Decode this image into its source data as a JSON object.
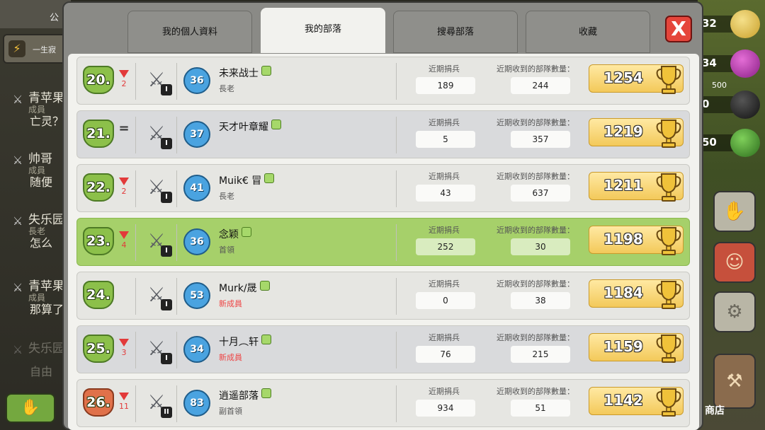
{
  "background": {
    "left": {
      "top_strip_label": "公",
      "clan_bar_label": "一生寂",
      "chat": [
        {
          "name": "青苹果",
          "role": "成員",
          "message": "亡灵？"
        },
        {
          "name": "帅哥",
          "role": "成員",
          "message": "随便"
        },
        {
          "name": "失乐园",
          "role": "長老",
          "message": "怎么"
        },
        {
          "name": "青苹果",
          "role": "成員",
          "message": "那算了"
        },
        {
          "name": "失乐园",
          "role": "",
          "message": "自由"
        }
      ]
    },
    "right": {
      "resources": [
        {
          "value": "32",
          "cap": ""
        },
        {
          "value": "34",
          "cap": ""
        },
        {
          "value": "0",
          "cap": "500"
        },
        {
          "value": "50",
          "cap": ""
        }
      ],
      "shop_label": "商店"
    }
  },
  "tabs": [
    {
      "label": "我的個人資料",
      "active": false
    },
    {
      "label": "我的部落",
      "active": true
    },
    {
      "label": "搜尋部落",
      "active": false
    },
    {
      "label": "收藏",
      "active": false
    }
  ],
  "close_label": "X",
  "labels": {
    "donated": "近期捐兵",
    "received": "近期收到的部隊數量："
  },
  "members": [
    {
      "rank": "20.",
      "trend": "down",
      "trend_value": "2",
      "war_level": "I",
      "xp": "36",
      "name": "未来战士",
      "role": "長老",
      "role_new": false,
      "donated": "189",
      "received": "244",
      "trophies": "1254",
      "self": false,
      "badge": "green"
    },
    {
      "rank": "21.",
      "trend": "same",
      "trend_value": "",
      "war_level": "I",
      "xp": "37",
      "name": "天才叶章耀",
      "role": "",
      "role_new": false,
      "donated": "5",
      "received": "357",
      "trophies": "1219",
      "self": false,
      "badge": "green"
    },
    {
      "rank": "22.",
      "trend": "down",
      "trend_value": "2",
      "war_level": "I",
      "xp": "41",
      "name": "Muik€ 冒",
      "role": "長老",
      "role_new": false,
      "donated": "43",
      "received": "637",
      "trophies": "1211",
      "self": false,
      "badge": "green"
    },
    {
      "rank": "23.",
      "trend": "down",
      "trend_value": "4",
      "war_level": "I",
      "xp": "36",
      "name": "念颖",
      "role": "首領",
      "role_new": false,
      "donated": "252",
      "received": "30",
      "trophies": "1198",
      "self": true,
      "badge": "green"
    },
    {
      "rank": "24.",
      "trend": "none",
      "trend_value": "",
      "war_level": "I",
      "xp": "53",
      "name": "Murk/晟",
      "role": "新成員",
      "role_new": true,
      "donated": "0",
      "received": "38",
      "trophies": "1184",
      "self": false,
      "badge": "green"
    },
    {
      "rank": "25.",
      "trend": "down",
      "trend_value": "3",
      "war_level": "I",
      "xp": "34",
      "name": "十月︵轩",
      "role": "新成員",
      "role_new": true,
      "donated": "76",
      "received": "215",
      "trophies": "1159",
      "self": false,
      "badge": "green"
    },
    {
      "rank": "26.",
      "trend": "down",
      "trend_value": "11",
      "war_level": "II",
      "xp": "83",
      "name": "逍遥部落",
      "role": "副首領",
      "role_new": false,
      "donated": "934",
      "received": "51",
      "trophies": "1142",
      "self": false,
      "badge": "bronze"
    }
  ]
}
